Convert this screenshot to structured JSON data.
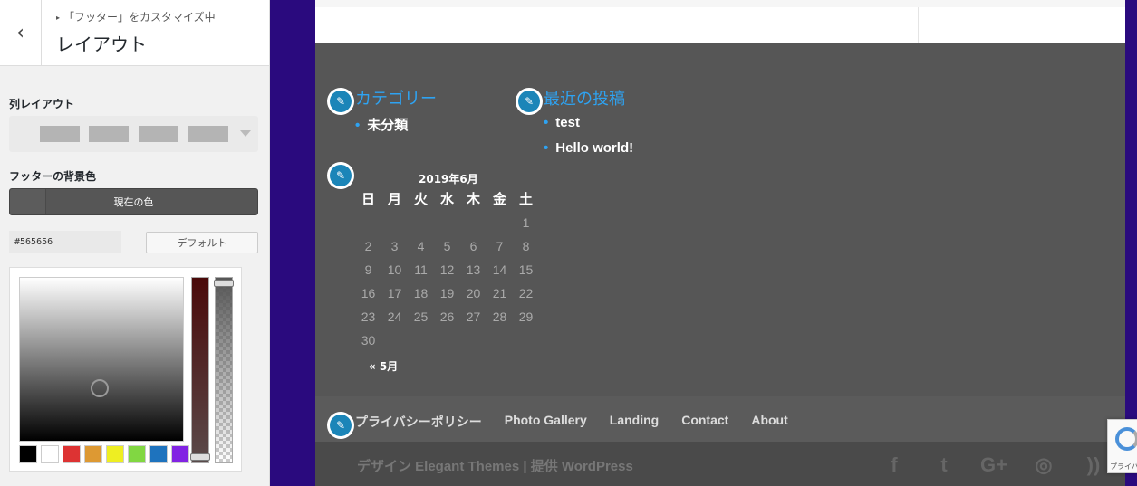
{
  "sidebar": {
    "breadcrumb": "「フッター」をカスタマイズ中",
    "title": "レイアウト",
    "column_layout_label": "列レイアウト",
    "bg_color_label": "フッターの背景色",
    "current_color_label": "現在の色",
    "hex_value": "#565656",
    "default_button": "デフォルト",
    "palette": [
      "#000000",
      "#ffffff",
      "#dd3333",
      "#dd9933",
      "#eeee22",
      "#81d742",
      "#1e73be",
      "#8224e3"
    ]
  },
  "footer": {
    "widget_categories": {
      "title": "カテゴリー",
      "items": [
        "未分類"
      ]
    },
    "widget_recent": {
      "title": "最近の投稿",
      "items": [
        "test",
        "Hello world!"
      ]
    },
    "calendar": {
      "caption": "2019年6月",
      "weekdays": [
        "日",
        "月",
        "火",
        "水",
        "木",
        "金",
        "土"
      ],
      "weeks": [
        [
          "",
          "",
          "",
          "",
          "",
          "",
          "1"
        ],
        [
          "2",
          "3",
          "4",
          "5",
          "6",
          "7",
          "8"
        ],
        [
          "9",
          "10",
          "11",
          "12",
          "13",
          "14",
          "15"
        ],
        [
          "16",
          "17",
          "18",
          "19",
          "20",
          "21",
          "22"
        ],
        [
          "23",
          "24",
          "25",
          "26",
          "27",
          "28",
          "29"
        ],
        [
          "30",
          "",
          "",
          "",
          "",
          "",
          ""
        ]
      ],
      "prev_link": "« 5月"
    },
    "nav": [
      "プライバシーポリシー",
      "Photo Gallery",
      "Landing",
      "Contact",
      "About"
    ],
    "credit": "デザイン Elegant Themes | 提供 WordPress",
    "socials": [
      {
        "icon": "facebook-icon",
        "glyph": "f"
      },
      {
        "icon": "twitter-icon",
        "glyph": "t"
      },
      {
        "icon": "google-plus-icon",
        "glyph": "G+"
      },
      {
        "icon": "instagram-icon",
        "glyph": "◎"
      },
      {
        "icon": "rss-icon",
        "glyph": "))"
      }
    ]
  },
  "recaptcha": {
    "text": "プライバシー 利用"
  },
  "colors": {
    "footer_bg": "#565656",
    "accent": "#2ea3f2",
    "outer_bg": "#2a0a7e"
  }
}
